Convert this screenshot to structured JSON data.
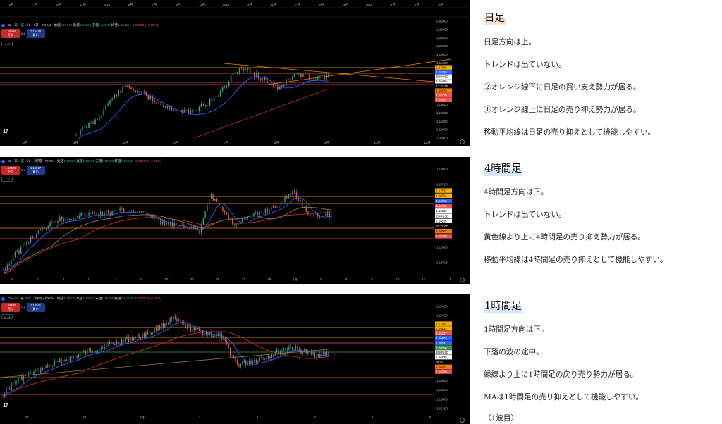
{
  "colors": {
    "candle_up": "#26a69a",
    "candle_down": "#ef5350",
    "ma_fast": "#2962ff",
    "ma_slow": "#c62828",
    "ma_mid": "#8e7c5a",
    "support_orange": "#f57c00",
    "support_yellow": "#ffb300",
    "support_green": "#43a047",
    "heading_daily_marker": "#fde2cd",
    "heading_other_marker": "#d4e6f7"
  },
  "charts": {
    "daily": {
      "title": "ユーロ／米ドル・1日・FXCM",
      "ohlc": {
        "open_label": "始値",
        "open": "1.16371",
        "high_label": "高値",
        "high": "1.16566",
        "low_label": "安値",
        "low": "1.16087",
        "close_label": "終値",
        "close": "1.16469",
        "change": "−0.00098 (−0.08%)"
      },
      "sell_price": "1.16459",
      "sell_label": "売り",
      "buy_price": "1.16479",
      "buy_label": "買い",
      "spread": "0.4",
      "collapse_label": "⌄ 11",
      "top_axis": [
        "5月",
        "7月",
        "9月",
        "11月",
        "2024",
        "5月",
        "7月",
        "9月",
        "11月",
        "2025",
        "3月",
        "5月",
        "7月",
        "9月",
        "11月",
        "2026",
        "3月",
        "5月",
        "9月"
      ],
      "bottom_axis": [
        "3月",
        "4月",
        "5月",
        "6月",
        "7月",
        "8月",
        "9月",
        "10月",
        "11月"
      ],
      "y_axis": [
        "0.95000",
        "1.22000",
        "1.21000",
        "1.20000",
        "1.19000",
        "1.18000",
        "1.17000",
        "1.16000",
        "1.15000",
        "1.14000",
        "1.13000",
        "1.12000",
        "1.11000",
        "1.10000",
        "1.09000"
      ],
      "price_tags": [
        {
          "text": "1.17099",
          "color": "#ffb300",
          "dark": true
        },
        {
          "text": "1.16790",
          "color": "#2962ff",
          "dark": false
        },
        {
          "text": "EURUSD",
          "color": "#ffffff",
          "dark": true
        },
        {
          "text": "1.16469",
          "color": "#ffffff",
          "dark": true
        },
        {
          "text": "13:24:18",
          "color": "#000000",
          "dark": false
        },
        {
          "text": "1.15823",
          "color": "#f57c00",
          "dark": true
        },
        {
          "text": "1.15729",
          "color": "#ef5350",
          "dark": false
        },
        {
          "text": "1.15201",
          "color": "#ef5350",
          "dark": false
        }
      ]
    },
    "h4": {
      "title": "ユーロ／米ドル・4時間・FXCM",
      "ohlc": {
        "open_label": "始値",
        "open": "1.16588",
        "high_label": "高値",
        "high": "1.16692",
        "low_label": "安値",
        "low": "1.16503",
        "close_label": "終値",
        "close": "1.16526",
        "change": "−0.00062 (−0.05%)"
      },
      "sell_price": "1.16526",
      "sell_label": "売り",
      "buy_price": "1.16537",
      "buy_label": "買い",
      "spread": "0.4",
      "collapse_label": "⌄ 11",
      "bottom_axis": [
        "4",
        "6",
        "8",
        "11",
        "13",
        "15",
        "20",
        "22",
        "25",
        "27",
        "29",
        "9月",
        "3",
        "5",
        "8",
        "10",
        "12",
        "17"
      ],
      "y_axis": [
        "1.18000",
        "1.17500",
        "1.17000",
        "1.16500",
        "1.16000",
        "1.15500",
        "1.15000"
      ],
      "price_tags": [
        {
          "text": "1.17537",
          "color": "#ffb300",
          "dark": true
        },
        {
          "text": "1.16924",
          "color": "#ffb300",
          "dark": true
        },
        {
          "text": "1.16710",
          "color": "#2962ff",
          "dark": false
        },
        {
          "text": "1.16495",
          "color": "#ef5350",
          "dark": false
        },
        {
          "text": "1.16382",
          "color": "#ffffff",
          "dark": true
        },
        {
          "text": "EURUSD",
          "color": "#ffffff",
          "dark": true
        },
        {
          "text": "1.16526",
          "color": "#ffffff",
          "dark": true
        },
        {
          "text": "01:23:07",
          "color": "#000000",
          "dark": false
        },
        {
          "text": "1.16087",
          "color": "#f57c00",
          "dark": true
        },
        {
          "text": "1.15729",
          "color": "#ef5350",
          "dark": false
        }
      ]
    },
    "h1": {
      "title": "ユーロ／米ドル・1時間・FXCM",
      "ohlc": {
        "open_label": "始値",
        "open": "1.16539",
        "high_label": "高値",
        "high": "1.16556",
        "low_label": "安値",
        "low": "1.16503",
        "close_label": "終値",
        "close": "1.16529",
        "change": "−0.00010 (−0.01%)"
      },
      "sell_price": "1.16529",
      "sell_label": "売り",
      "buy_price": "1.16541",
      "buy_label": "買い",
      "spread": "0.4",
      "collapse_label": "⌄ 11",
      "bottom_axis": [
        "28",
        "29",
        "9月",
        "2",
        "3",
        "4",
        "5",
        "6"
      ],
      "y_axis": [
        "1.17600",
        "1.17400",
        "1.17200",
        "1.17000",
        "1.16800",
        "1.16600",
        "1.16400",
        "1.16200",
        "1.16000",
        "1.15800",
        "1.15600",
        "1.15400"
      ],
      "price_tags": [
        {
          "text": "1.17082",
          "color": "#ffb300",
          "dark": true
        },
        {
          "text": "1.16924",
          "color": "#ffb300",
          "dark": true
        },
        {
          "text": "1.16737",
          "color": "#ef5350",
          "dark": false
        },
        {
          "text": "1.16602",
          "color": "#2962ff",
          "dark": false
        },
        {
          "text": "1.16541",
          "color": "#2962ff",
          "dark": false
        },
        {
          "text": "1.16556",
          "color": "#43a047",
          "dark": false
        },
        {
          "text": "EURUSD",
          "color": "#ffffff",
          "dark": true
        },
        {
          "text": "1.16529",
          "color": "#ffffff",
          "dark": true
        },
        {
          "text": "25:57",
          "color": "#000000",
          "dark": false
        },
        {
          "text": "1.16087",
          "color": "#f57c00",
          "dark": true
        },
        {
          "text": "1.15729",
          "color": "#ef5350",
          "dark": false
        }
      ]
    }
  },
  "analysis": {
    "daily": {
      "heading": "日足",
      "lines": [
        "日足方向は上。",
        "トレンドは出ていない。",
        "②オレンジ線下に日足の買い支え勢力が居る。",
        "①オレンジ線上に日足の売り抑え勢力が居る。",
        "移動平均線は日足の売り抑えとして機能しやすい。"
      ]
    },
    "h4": {
      "heading": "4時間足",
      "lines": [
        "4時間足方向は下。",
        "トレンドは出ていない。",
        "黄色線より上に4時間足の売り抑え勢力が居る。",
        "移動平均線は4時間足の売り抑えとして機能しやすい。"
      ]
    },
    "h1": {
      "heading": "1時間足",
      "lines": [
        "1時間足方向は下。",
        "下落の波の途中。",
        "緑線より上に1時間足の戻り売り勢力が居る。",
        "MAは1時間足の売り抑えとして機能しやすい。",
        "（1波目）"
      ]
    }
  }
}
